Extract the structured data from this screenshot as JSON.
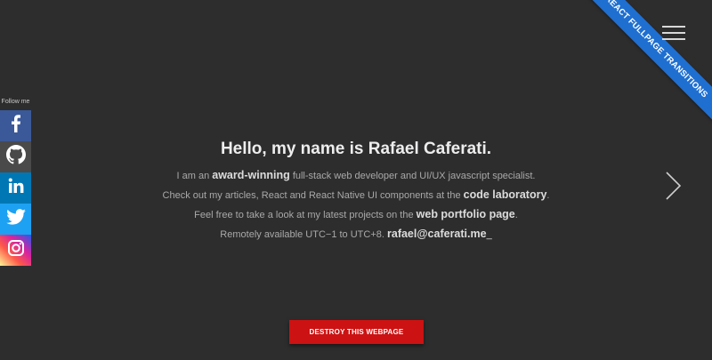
{
  "ribbon": {
    "text": "REACT FULLPAGE TRANSITIONS",
    "color": "#1f6fd1"
  },
  "nav": {
    "menu_icon": "hamburger-icon"
  },
  "social": {
    "title": "Follow me",
    "items": [
      {
        "name": "facebook",
        "icon": "facebook-icon",
        "color": "#3b5998"
      },
      {
        "name": "github",
        "icon": "github-icon",
        "color": "#4a4a4a"
      },
      {
        "name": "linkedin",
        "icon": "linkedin-icon",
        "color": "#0077b5"
      },
      {
        "name": "twitter",
        "icon": "twitter-icon",
        "color": "#1da1f2"
      },
      {
        "name": "instagram",
        "icon": "instagram-icon",
        "color": "#d6249f"
      }
    ]
  },
  "intro": {
    "headline": "Hello, my name is Rafael Caferati.",
    "line1": {
      "pre": "I am an",
      "bold": "award-winning",
      "post": "full-stack web developer and UI/UX javascript specialist."
    },
    "line2": {
      "pre": "Check out my articles, React and React Native UI components at the",
      "link": "code laboratory",
      "post": "."
    },
    "line3": {
      "pre": "Feel free to take a look at my latest projects on the",
      "link": "web portfolio page",
      "post": "."
    },
    "line4": {
      "pre": "Remotely available UTC−1 to UTC+8.",
      "email": "rafael@caferati.me",
      "cursor": "_"
    }
  },
  "next_arrow": {
    "icon": "chevron-right-icon"
  },
  "button": {
    "label": "DESTROY THIS WEBPAGE",
    "color": "#cc1212"
  }
}
